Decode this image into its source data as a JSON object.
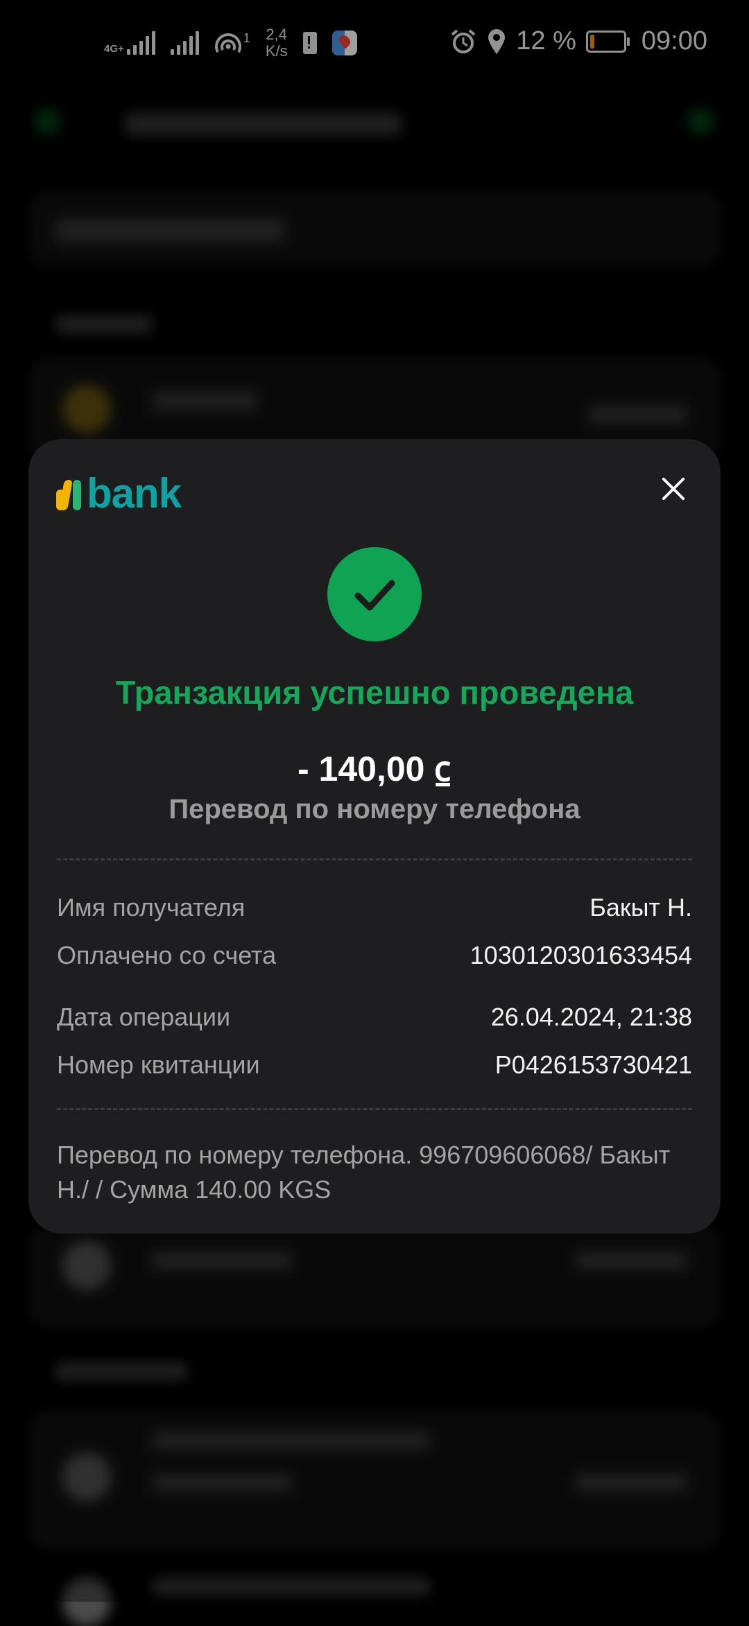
{
  "status_bar": {
    "network_tag": "4G+",
    "net_speed_value": "2,4",
    "net_speed_unit": "K/s",
    "hotspot_count": "1",
    "battery_percent": "12 %",
    "battery_level": 0.12,
    "time": "09:00",
    "icons": [
      "signal-icon",
      "signal-icon",
      "hotspot-icon",
      "battery-alert-icon",
      "maps-app-icon",
      "alarm-icon",
      "location-icon",
      "battery-icon"
    ]
  },
  "modal": {
    "logo_text": "bank",
    "logo_colors": {
      "m_left": "#f5b400",
      "m_right": "#2bb673",
      "word": "#10a2a0"
    },
    "status_icon": "check-icon",
    "title": "Транзакция успешно проведена",
    "amount": "- 140,00 ⃀",
    "subtitle": "Перевод по номеру телефона",
    "details": [
      {
        "label": "Имя получателя",
        "value": "Бакыт Н."
      },
      {
        "label": "Оплачено со счета",
        "value": "1030120301633454"
      },
      {
        "label": "Дата операции",
        "value": "26.04.2024, 21:38"
      },
      {
        "label": "Номер квитанции",
        "value": "P0426153730421"
      }
    ],
    "description": "Перевод по номеру телефона. 996709606068/ Бакыт Н./ / Сумма 140.00 KGS"
  },
  "colors": {
    "success_green": "#15a85a",
    "modal_bg": "#1e1e20",
    "battery_low": "#f08a1c"
  }
}
